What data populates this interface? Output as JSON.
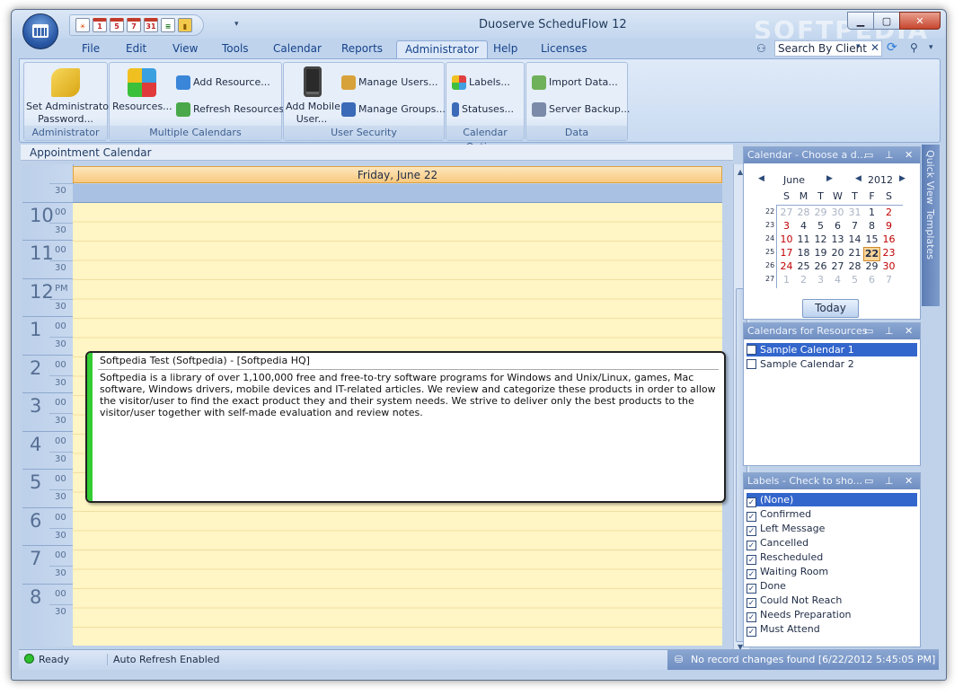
{
  "window": {
    "title": "Duoserve ScheduFlow 12",
    "watermark": "SOFTPEDIA"
  },
  "qat": {
    "icons": [
      "today-icon",
      "day-view-icon",
      "work-week-icon",
      "week-icon",
      "month-icon",
      "timeline-icon",
      "exit-icon"
    ],
    "cal_nums": [
      "1",
      "5",
      "7",
      "31"
    ]
  },
  "menu": [
    "File",
    "Edit",
    "View",
    "Tools",
    "Calendar",
    "Reports",
    "Administrator",
    "Help",
    "Licenses"
  ],
  "search": {
    "value": "Search By Client"
  },
  "ribbon": {
    "groups": [
      {
        "caption": "Administrator",
        "buttons": [
          "Set Administrator Password..."
        ]
      },
      {
        "caption": "Multiple Calendars",
        "buttons": [
          "Resources...",
          "Add Resource...",
          "Refresh Resources"
        ]
      },
      {
        "caption": "User Security",
        "buttons": [
          "Add Mobile User...",
          "Manage Users...",
          "Manage Groups..."
        ]
      },
      {
        "caption": "Calendar Options",
        "buttons": [
          "Labels...",
          "Statuses..."
        ]
      },
      {
        "caption": "Data",
        "buttons": [
          "Import Data...",
          "Server Backup..."
        ]
      }
    ],
    "set_admin_line1": "Set Administrator",
    "set_admin_line2": "Password...",
    "add_mobile_line1": "Add Mobile",
    "add_mobile_line2": "User..."
  },
  "appointment_calendar": {
    "header": "Appointment Calendar",
    "day": "Friday, June 22",
    "hours": [
      {
        "h": "",
        "m": ""
      },
      {
        "h": "10",
        "m": "00"
      },
      {
        "h": "11",
        "m": "00"
      },
      {
        "h": "12",
        "m": "PM"
      },
      {
        "h": "1",
        "m": "00"
      },
      {
        "h": "2",
        "m": "00"
      },
      {
        "h": "3",
        "m": "00"
      },
      {
        "h": "4",
        "m": "00"
      },
      {
        "h": "5",
        "m": "00"
      },
      {
        "h": "6",
        "m": "00"
      },
      {
        "h": "7",
        "m": "00"
      },
      {
        "h": "8",
        "m": "00"
      }
    ],
    "half_label": "30",
    "appointment": {
      "title": "Softpedia Test (Softpedia) - [Softpedia HQ]",
      "body": "Softpedia is a library of over 1,100,000 free and free-to-try software programs for Windows and Unix/Linux, games, Mac software, Windows drivers, mobile devices and IT-related articles. We review and categorize these products in order to allow the visitor/user to find the exact product they and their system needs. We strive to deliver only the best products to the visitor/user together with self-made evaluation and review notes.",
      "label_color": "#33cc33"
    }
  },
  "side_tabs": [
    "Quick View",
    "Templates"
  ],
  "mini_calendar": {
    "header": "Calendar - Choose a d...",
    "month": "June",
    "year": "2012",
    "weekdays": [
      "S",
      "M",
      "T",
      "W",
      "T",
      "F",
      "S"
    ],
    "weeks": [
      {
        "wk": "22",
        "days": [
          "27",
          "28",
          "29",
          "30",
          "31",
          "1",
          "2"
        ]
      },
      {
        "wk": "23",
        "days": [
          "3",
          "4",
          "5",
          "6",
          "7",
          "8",
          "9"
        ]
      },
      {
        "wk": "24",
        "days": [
          "10",
          "11",
          "12",
          "13",
          "14",
          "15",
          "16"
        ]
      },
      {
        "wk": "25",
        "days": [
          "17",
          "18",
          "19",
          "20",
          "21",
          "22",
          "23"
        ]
      },
      {
        "wk": "26",
        "days": [
          "24",
          "25",
          "26",
          "27",
          "28",
          "29",
          "30"
        ]
      },
      {
        "wk": "27",
        "days": [
          "1",
          "2",
          "3",
          "4",
          "5",
          "6",
          "7"
        ]
      }
    ],
    "today_button": "Today"
  },
  "resources_panel": {
    "header": "Calendars for Resources",
    "items": [
      {
        "label": "Sample Calendar 1",
        "checked": false
      },
      {
        "label": "Sample Calendar 2",
        "checked": false
      }
    ]
  },
  "labels_panel": {
    "header": "Labels - Check to sho...",
    "items": [
      "(None)",
      "Confirmed",
      "Left Message",
      "Cancelled",
      "Rescheduled",
      "Waiting Room",
      "Done",
      "Could Not Reach",
      "Needs Preparation",
      "Must Attend"
    ]
  },
  "statusbar": {
    "ready": "Ready",
    "refresh": "Auto Refresh Enabled",
    "changes": "No record changes found [6/22/2012 5:45:05 PM]"
  }
}
